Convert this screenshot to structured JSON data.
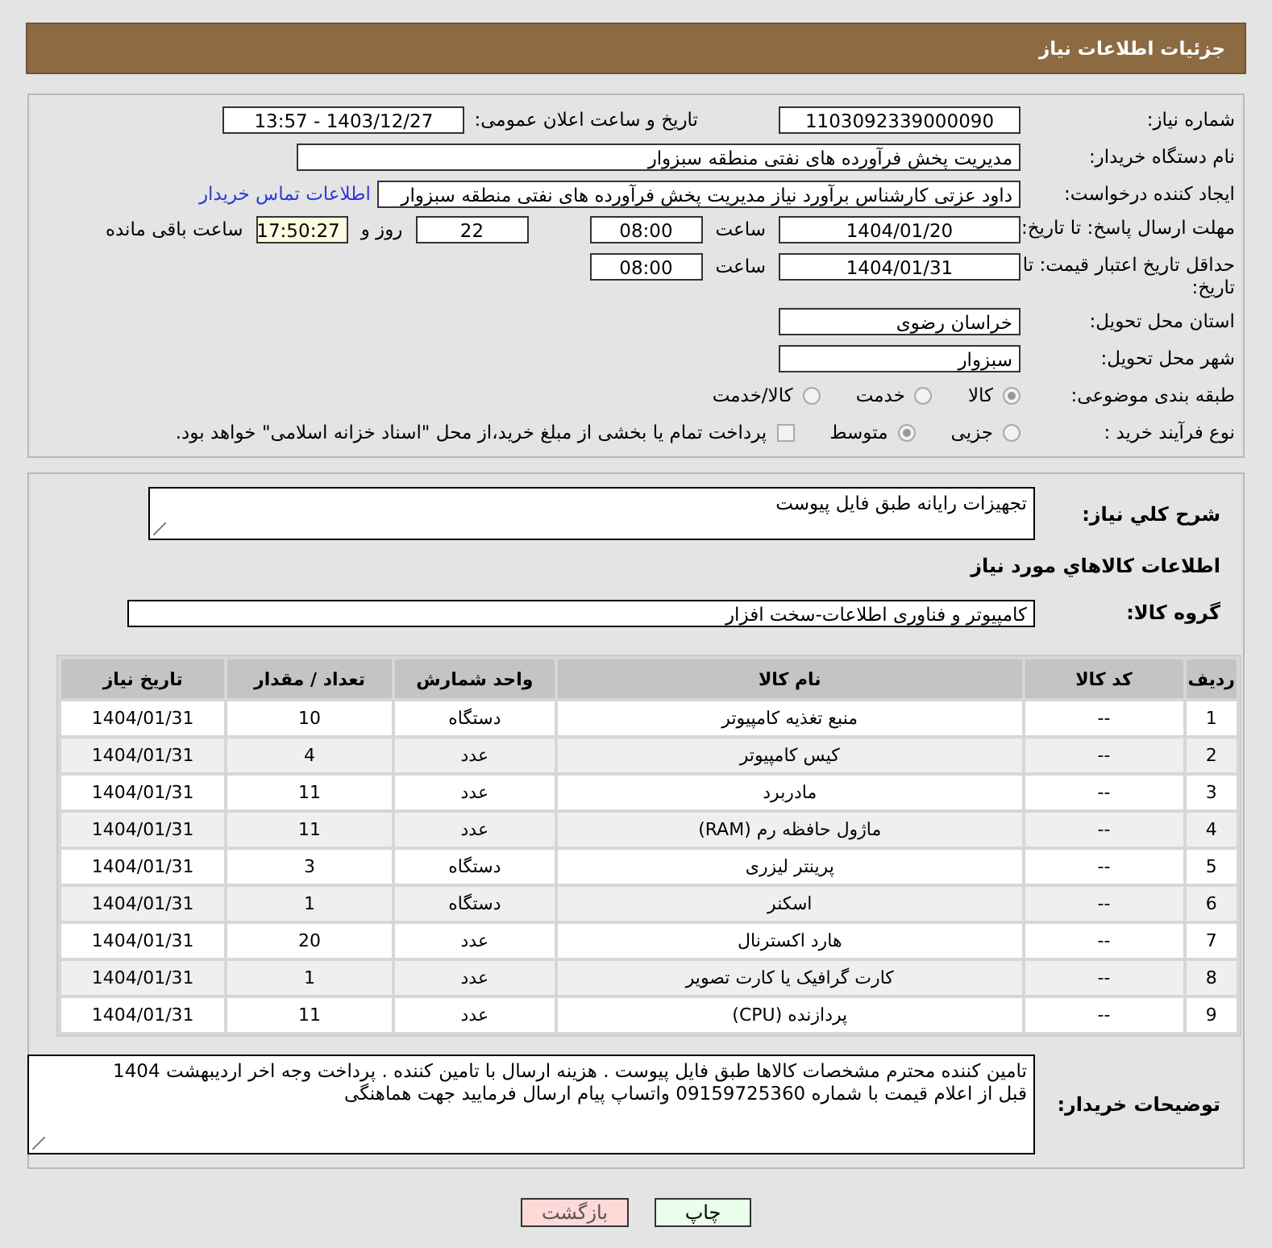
{
  "header": {
    "title": "جزئیات اطلاعات نیاز"
  },
  "need_number": {
    "label": "شماره نیاز:",
    "value": "1103092339000090"
  },
  "announce": {
    "label": "تاریخ و ساعت اعلان عمومی:",
    "value": "1403/12/27 - 13:57"
  },
  "buyer": {
    "label": "نام دستگاه خریدار:",
    "value": "مدیریت پخش فرآورده های نفتی منطقه سبزوار"
  },
  "creator": {
    "label": "ایجاد کننده درخواست:",
    "value": "داود عزتی کارشناس برآورد نیاز مدیریت پخش فرآورده های نفتی منطقه سبزوار",
    "link": "اطلاعات تماس خریدار"
  },
  "deadline": {
    "label": "مهلت ارسال پاسخ: تا تاریخ:",
    "date": "1404/01/20",
    "time_label": "ساعت",
    "time": "08:00",
    "days": "22",
    "days_label": "روز و",
    "remaining": "17:50:27",
    "remaining_label": "ساعت باقی مانده"
  },
  "validity": {
    "label": "حداقل تاریخ اعتبار قیمت: تا تاریخ:",
    "date": "1404/01/31",
    "time_label": "ساعت",
    "time": "08:00"
  },
  "province": {
    "label": "استان محل تحویل:",
    "value": "خراسان رضوی"
  },
  "city": {
    "label": "شهر محل تحویل:",
    "value": "سبزوار"
  },
  "category": {
    "label": "طبقه بندی موضوعی:",
    "options": [
      {
        "label": "کالا",
        "selected": true
      },
      {
        "label": "خدمت",
        "selected": false
      },
      {
        "label": "کالا/خدمت",
        "selected": false
      }
    ]
  },
  "purchase_type": {
    "label": "نوع فرآیند خرید :",
    "options": [
      {
        "label": "جزیی",
        "selected": false
      },
      {
        "label": "متوسط",
        "selected": true
      }
    ],
    "payment_checkbox": {
      "label": "پرداخت تمام یا بخشی از مبلغ خرید،از محل \"اسناد خزانه اسلامی\" خواهد بود.",
      "checked": false
    }
  },
  "description": {
    "label": "شرح کلي نياز:",
    "value": "تجهیزات رایانه طبق فایل پیوست"
  },
  "goods_heading": "اطلاعات کالاهاي مورد نياز",
  "goods_group": {
    "label": "گروه کالا:",
    "value": "کامپیوتر و فناوری اطلاعات-سخت افزار"
  },
  "table": {
    "columns": [
      "ردیف",
      "کد کالا",
      "نام کالا",
      "واحد شمارش",
      "تعداد / مقدار",
      "تاریخ نیاز"
    ],
    "rows": [
      [
        "1",
        "--",
        "منبع تغذیه کامپیوتر",
        "دستگاه",
        "10",
        "1404/01/31"
      ],
      [
        "2",
        "--",
        "کیس کامپیوتر",
        "عدد",
        "4",
        "1404/01/31"
      ],
      [
        "3",
        "--",
        "مادربرد",
        "عدد",
        "11",
        "1404/01/31"
      ],
      [
        "4",
        "--",
        "ماژول حافظه رم (RAM)",
        "عدد",
        "11",
        "1404/01/31"
      ],
      [
        "5",
        "--",
        "پرینتر لیزری",
        "دستگاه",
        "3",
        "1404/01/31"
      ],
      [
        "6",
        "--",
        "اسکنر",
        "دستگاه",
        "1",
        "1404/01/31"
      ],
      [
        "7",
        "--",
        "هارد اکسترنال",
        "عدد",
        "20",
        "1404/01/31"
      ],
      [
        "8",
        "--",
        "کارت گرافیک یا کارت تصویر",
        "عدد",
        "1",
        "1404/01/31"
      ],
      [
        "9",
        "--",
        "پردازنده (CPU)",
        "عدد",
        "11",
        "1404/01/31"
      ]
    ]
  },
  "notes": {
    "label": "توضیحات خریدار:",
    "lines": [
      "تامین کننده محترم مشخصات کالاها طبق فایل پیوست . هزینه ارسال با تامین کننده . پرداخت وجه اخر اردیبهشت 1404",
      "قبل از اعلام قیمت با شماره 09159725360 واتساپ پیام ارسال فرمایید جهت هماهنگی"
    ]
  },
  "buttons": [
    {
      "label": "چاپ",
      "kind": "print"
    },
    {
      "label": "بازگشت",
      "kind": "back"
    }
  ]
}
